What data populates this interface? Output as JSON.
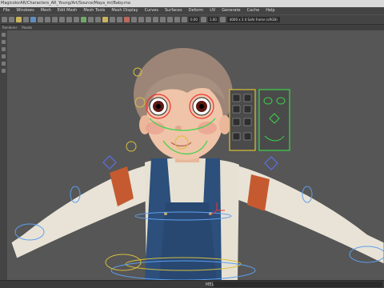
{
  "window": {
    "title": "MagicolorAR/Characters_AR_Young/Art/Source/Maya_mi/Baby.ma"
  },
  "menu": {
    "items": [
      "File",
      "Windows",
      "Mesh",
      "Edit Mesh",
      "Mesh Tools",
      "Mesh Display",
      "Curves",
      "Surfaces",
      "Deform",
      "UV",
      "Generate",
      "Cache",
      "Help"
    ]
  },
  "toolbar": {
    "field_a": "0.00",
    "field_b": "1.00",
    "resolution": "4000 x 3 4 Safe frame (sRGB)"
  },
  "panel": {
    "items": [
      "Renderer",
      "Panels"
    ]
  },
  "status": {
    "mel_label": "MEL"
  }
}
